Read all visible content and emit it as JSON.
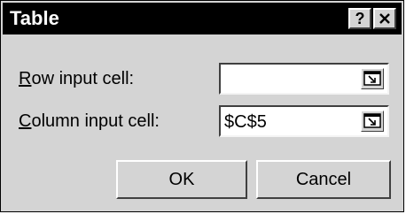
{
  "window": {
    "title": "Table",
    "help_label": "?"
  },
  "fields": {
    "row_input": {
      "label_accesskey": "R",
      "label_rest": "ow input cell:",
      "value": ""
    },
    "column_input": {
      "label_accesskey": "C",
      "label_rest": "olumn input cell:",
      "value": "$C$5"
    }
  },
  "buttons": {
    "ok_label": "OK",
    "cancel_label": "Cancel"
  },
  "icons": {
    "help": "help-icon",
    "close": "close-icon",
    "collapse_dialog": "collapse-dialog-icon"
  },
  "colors": {
    "title_bar": "#000000",
    "title_text": "#ffffff",
    "dialog_face": "#d4d4d4",
    "field_background": "#ffffff"
  }
}
